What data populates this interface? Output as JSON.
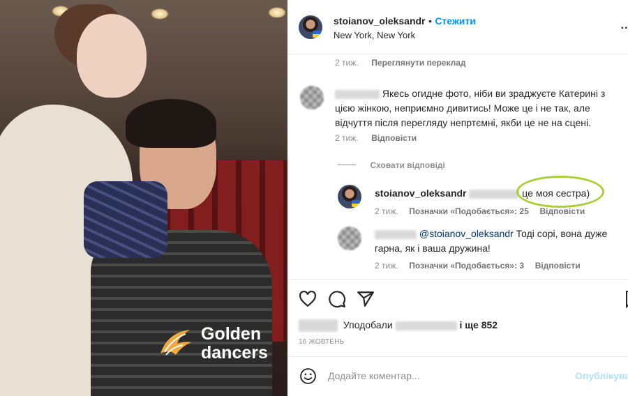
{
  "post": {
    "username": "stoianov_oleksandr",
    "dot": "•",
    "follow_label": "Стежити",
    "location": "New York, New York",
    "more_label": "..."
  },
  "photo": {
    "logo_line1": "Golden",
    "logo_line2": "dancers"
  },
  "comments": [
    {
      "age": "2 тиж.",
      "translate_label": "Переглянути переклад"
    },
    {
      "text": "Якесь огидне фото, ніби ви зраджуєте Катерині з цією жінкою, неприємно дивитись! Може це і не так, але відчуття після перегляду непртємні, якби це не на сцені.",
      "age": "2 тиж.",
      "reply_label": "Відповісти",
      "hide_replies_label": "Сховати відповіді"
    }
  ],
  "replies": [
    {
      "username": "stoianov_oleksandr",
      "text": "це моя сестра)",
      "age": "2 тиж.",
      "likes_label": "Позначки «Подобається»: 25",
      "reply_label": "Відповісти"
    },
    {
      "mention": "@stoianov_oleksandr",
      "text": " Тоді сорі, вона дуже гарна, як і ваша дружина!",
      "age": "2 тиж.",
      "likes_label": "Позначки «Подобається»: 3",
      "reply_label": "Відповісти"
    }
  ],
  "likes": {
    "prefix": "Уподобали",
    "suffix": "і ще 852"
  },
  "date": "16 ЖОВТЕНЬ",
  "composer": {
    "placeholder": "Додайте коментар...",
    "publish_label": "Опублікувати"
  },
  "colors": {
    "link_blue": "#0095f6",
    "highlight_circle": "#a7d131"
  }
}
